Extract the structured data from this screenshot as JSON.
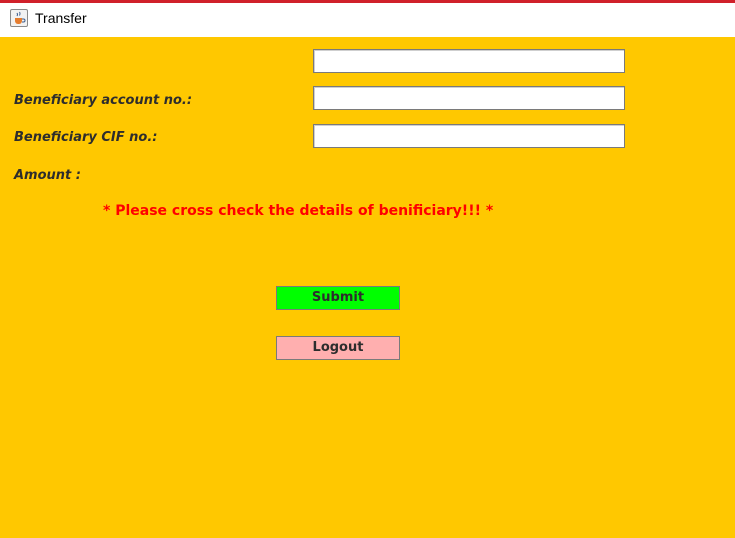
{
  "window": {
    "title": "Transfer",
    "icon": "java-cup-icon"
  },
  "form": {
    "unlabeled_field_value": "",
    "beneficiary_account_label": "Beneficiary account no.:",
    "beneficiary_account_value": "",
    "beneficiary_cif_label": "Beneficiary CIF no.:",
    "beneficiary_cif_value": "",
    "amount_label": "Amount :"
  },
  "warning_text": "* Please cross check the details of benificiary!!! *",
  "buttons": {
    "submit_label": "Submit",
    "logout_label": "Logout"
  },
  "colors": {
    "background": "#ffc800",
    "submit_button": "#00ff00",
    "logout_button": "#ffafaf",
    "warning": "#ff0000",
    "title_accent": "#d0202a"
  }
}
